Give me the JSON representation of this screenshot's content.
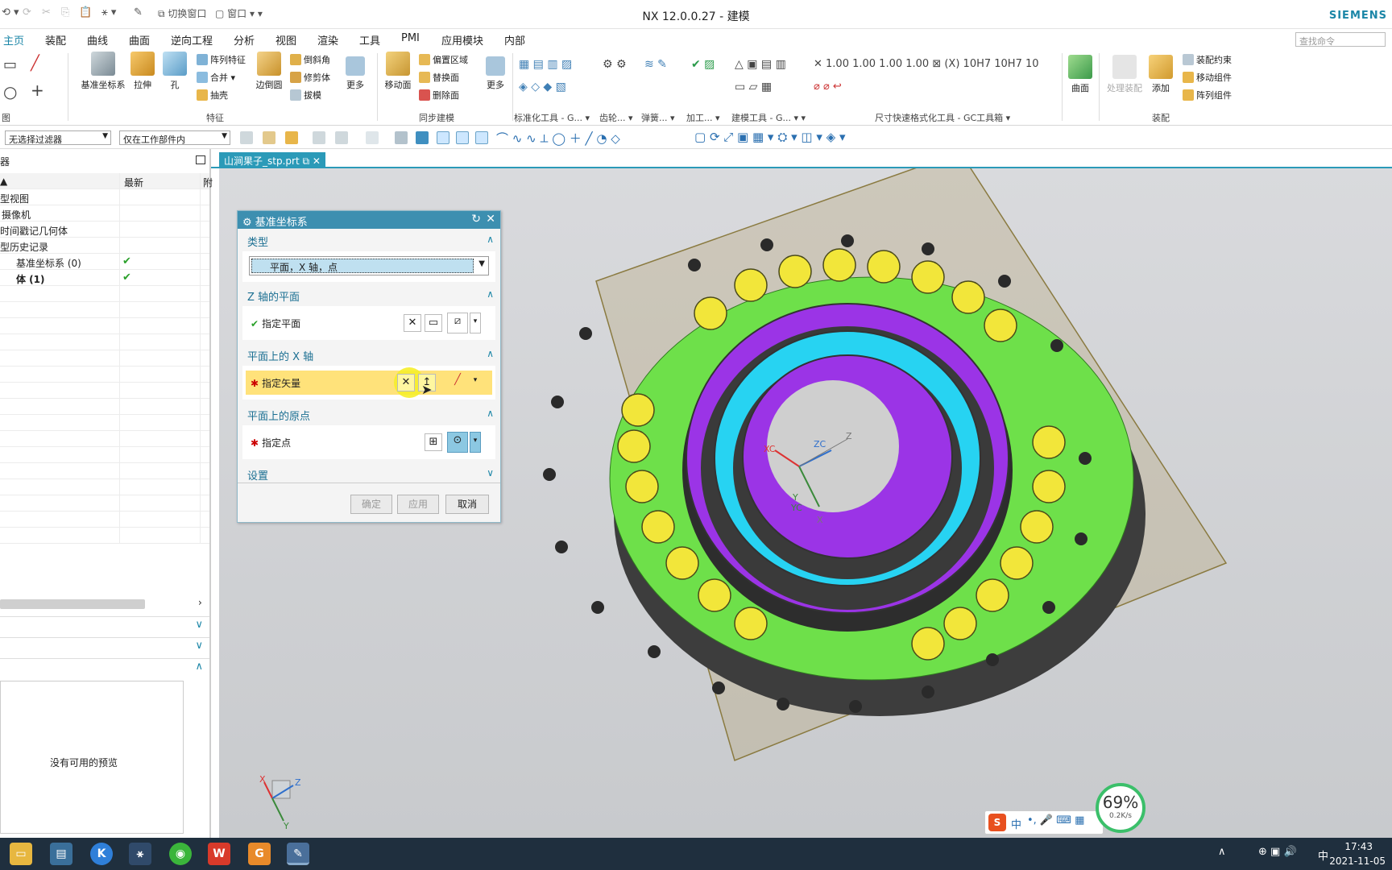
{
  "window": {
    "title": "NX 12.0.0.27 - 建模",
    "brand": "SIEMENS",
    "quick_access": {
      "switch_window": "切换窗口",
      "window_menu": "窗口"
    },
    "search_placeholder": "查找命令"
  },
  "menu_tabs": [
    "主页",
    "装配",
    "曲线",
    "曲面",
    "逆向工程",
    "分析",
    "视图",
    "渲染",
    "工具",
    "PMI",
    "应用模块",
    "内部"
  ],
  "active_tab": "主页",
  "ribbon": {
    "feature_group": {
      "datum_csys": "基准坐标系",
      "extrude": "拉伸",
      "hole": "孔",
      "pattern_feature": "阵列特征",
      "unite": "合并",
      "shell": "抽壳",
      "edge_blend": "边倒圆",
      "chamfer": "倒斜角",
      "trim_body": "修剪体",
      "draft": "拔模",
      "more": "更多",
      "label": "特征"
    },
    "sync_group": {
      "move_face": "移动面",
      "offset_region": "偏置区域",
      "replace_face": "替换面",
      "delete_face": "删除面",
      "more": "更多",
      "label": "同步建模"
    },
    "std_tools_label": "标准化工具 - G...",
    "gear_label": "齿轮...",
    "spring_label": "弹簧...",
    "machining_label": "加工...",
    "modeling_tools_label": "建模工具 - G...",
    "dim_label": "尺寸快速格式化工具 - GC工具箱",
    "surface_label": "曲面",
    "assembly_group": {
      "process_assembly": "处理装配",
      "add": "添加",
      "constraint": "装配约束",
      "move_component": "移动组件",
      "pattern_component": "阵列组件",
      "label": "装配"
    },
    "sketch_group_label": "图"
  },
  "selection_bar": {
    "filter": "无选择过滤器",
    "scope": "仅在工作部件内"
  },
  "navigator": {
    "title": "器",
    "col_latest": "最新",
    "col_extra": "附",
    "rows": [
      {
        "label": "型视图",
        "check": ""
      },
      {
        "label": "摄像机",
        "check": ""
      },
      {
        "label": "时间戳记几何体",
        "check": ""
      },
      {
        "label": "型历史记录",
        "check": ""
      },
      {
        "label": "基准坐标系 (0)",
        "check": "✔"
      },
      {
        "label": "体 (1)",
        "check": "✔"
      }
    ],
    "preview_text": "没有可用的预览"
  },
  "file_tab": "山涧果子_stp.prt",
  "dialog": {
    "title": "基准坐标系",
    "sec_type": "类型",
    "type_value": "平面，X 轴，点",
    "sec_z_plane": "Z 轴的平面",
    "specify_plane": "指定平面",
    "sec_x_axis": "平面上的 X 轴",
    "specify_vector": "指定矢量",
    "sec_origin": "平面上的原点",
    "specify_point": "指定点",
    "sec_settings": "设置",
    "ok": "确定",
    "apply": "应用",
    "cancel": "取消"
  },
  "viewport_labels": {
    "xc": "XC",
    "zc": "ZC",
    "z": "Z",
    "y": "Y",
    "yc": "YC",
    "x": "X"
  },
  "triad": {
    "x": "X",
    "y": "Y",
    "z": "Z"
  },
  "network": {
    "percent": "69%",
    "rate": "0.2K/s"
  },
  "taskbar": {
    "time": "17:43",
    "date": "2021-11-05",
    "ime": "中"
  },
  "ime_bar": {
    "label": "中"
  },
  "colors": {
    "accent": "#1b86a7",
    "green_part": "#6ee04a",
    "purple_ring": "#9b34e6",
    "cyan_ring": "#27d3f2",
    "yellow_hole": "#f2e63a"
  }
}
